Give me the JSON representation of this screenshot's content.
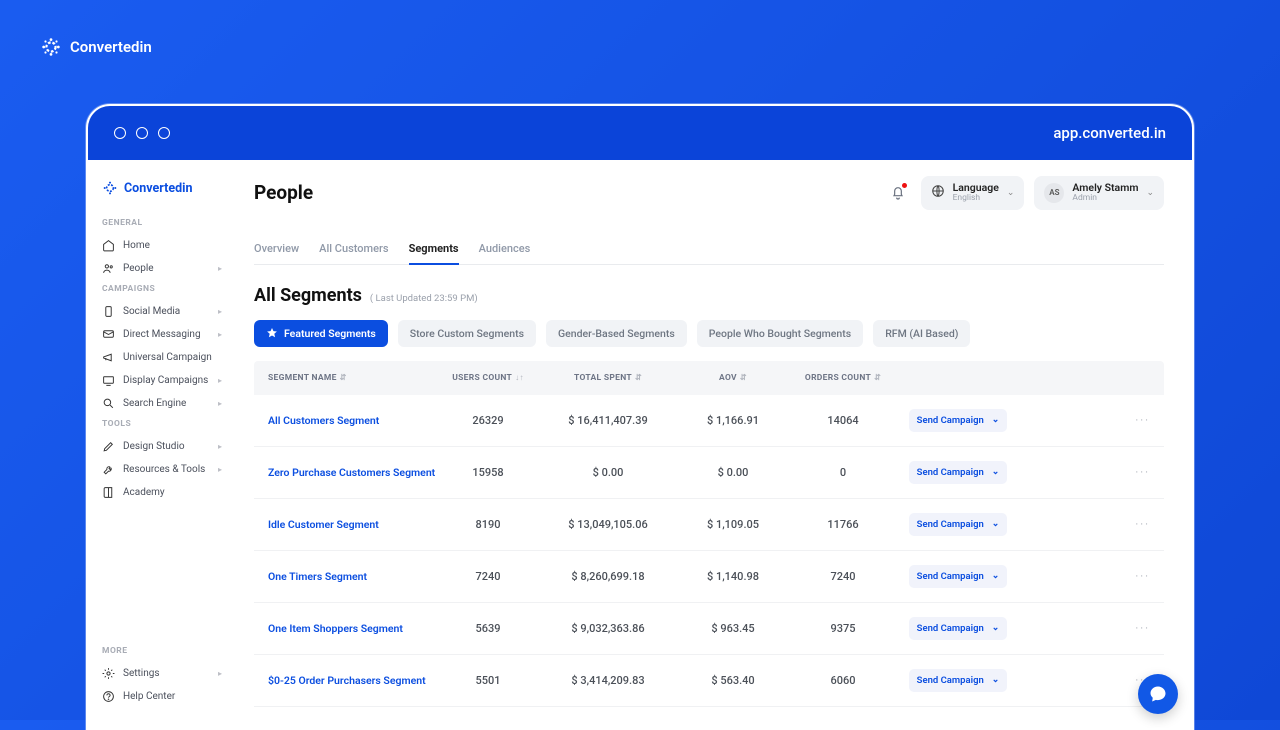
{
  "brand": "Convertedin",
  "browser_url": "app.converted.in",
  "sidebar": {
    "sections": {
      "general": "GENERAL",
      "campaigns": "CAMPAIGNS",
      "tools": "TOOLS",
      "more": "MORE"
    },
    "items": {
      "home": "Home",
      "people": "People",
      "social": "Social Media",
      "dm": "Direct Messaging",
      "uc": "Universal Campaign",
      "dc": "Display Campaigns",
      "se": "Search Engine",
      "ds": "Design Studio",
      "rt": "Resources & Tools",
      "ac": "Academy",
      "settings": "Settings",
      "help": "Help Center"
    }
  },
  "header": {
    "title": "People",
    "lang_label": "Language",
    "lang_value": "English",
    "user_name": "Amely Stamm",
    "user_role": "Admin",
    "user_initials": "AS"
  },
  "tabs": {
    "overview": "Overview",
    "all": "All Customers",
    "segments": "Segments",
    "audiences": "Audiences"
  },
  "subheader": {
    "title": "All Segments",
    "updated": "( Last Updated 23:59 PM)"
  },
  "filters": {
    "featured": "Featured Segments",
    "store": "Store Custom Segments",
    "gender": "Gender-Based Segments",
    "bought": "People Who Bought Segments",
    "rfm": "RFM (AI Based)"
  },
  "columns": {
    "name": "SEGMENT NAME",
    "users": "USERS COUNT",
    "spent": "TOTAL SPENT",
    "aov": "AOV",
    "orders": "ORDERS COUNT"
  },
  "send_label": "Send Campaign",
  "rows": [
    {
      "name": "All Customers Segment",
      "users": "26329",
      "spent": "$ 16,411,407.39",
      "aov": "$ 1,166.91",
      "orders": "14064"
    },
    {
      "name": "Zero Purchase Customers Segment",
      "users": "15958",
      "spent": "$ 0.00",
      "aov": "$ 0.00",
      "orders": "0"
    },
    {
      "name": "Idle Customer Segment",
      "users": "8190",
      "spent": "$ 13,049,105.06",
      "aov": "$ 1,109.05",
      "orders": "11766"
    },
    {
      "name": "One Timers Segment",
      "users": "7240",
      "spent": "$ 8,260,699.18",
      "aov": "$ 1,140.98",
      "orders": "7240"
    },
    {
      "name": "One Item Shoppers Segment",
      "users": "5639",
      "spent": "$ 9,032,363.86",
      "aov": "$ 963.45",
      "orders": "9375"
    },
    {
      "name": "$0-25 Order Purchasers Segment",
      "users": "5501",
      "spent": "$ 3,414,209.83",
      "aov": "$ 563.40",
      "orders": "6060"
    }
  ]
}
